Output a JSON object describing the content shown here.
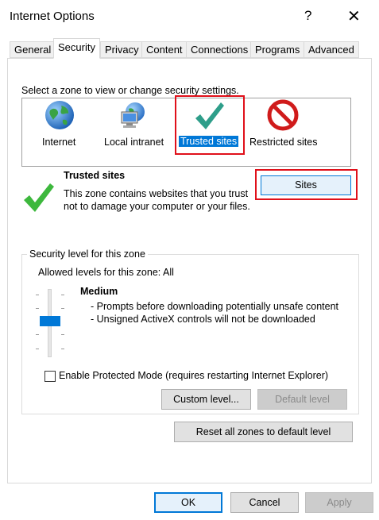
{
  "window": {
    "title": "Internet Options",
    "help_glyph": "?",
    "close_glyph": "✕"
  },
  "tabs": [
    {
      "label": "General"
    },
    {
      "label": "Security",
      "active": true
    },
    {
      "label": "Privacy"
    },
    {
      "label": "Content"
    },
    {
      "label": "Connections"
    },
    {
      "label": "Programs"
    },
    {
      "label": "Advanced"
    }
  ],
  "security": {
    "select_label": "Select a zone to view or change security settings.",
    "zones": [
      {
        "label": "Internet",
        "icon": "globe-icon"
      },
      {
        "label": "Local intranet",
        "icon": "intranet-icon"
      },
      {
        "label": "Trusted sites",
        "icon": "checkmark-icon",
        "selected": true
      },
      {
        "label": "Restricted sites",
        "icon": "no-entry-icon"
      }
    ],
    "zone_title": "Trusted sites",
    "zone_description": "This zone contains websites that you trust not to damage your computer or your files.",
    "sites_button": "Sites",
    "group_label": "Security level for this zone",
    "allowed_levels": "Allowed levels for this zone: All",
    "level_name": "Medium",
    "level_points": [
      "- Prompts before downloading potentially unsafe content",
      "- Unsigned ActiveX controls will not be downloaded"
    ],
    "slider_level": "Medium",
    "protected_mode_label": "Enable Protected Mode (requires restarting Internet Explorer)",
    "protected_mode_checked": false,
    "custom_level_button": "Custom level...",
    "default_level_button": "Default level",
    "reset_button": "Reset all zones to default level"
  },
  "footer": {
    "ok": "OK",
    "cancel": "Cancel",
    "apply": "Apply"
  },
  "colors": {
    "accent": "#0078d7",
    "highlight_box": "#e0101a",
    "check_green": "#3cb371"
  }
}
